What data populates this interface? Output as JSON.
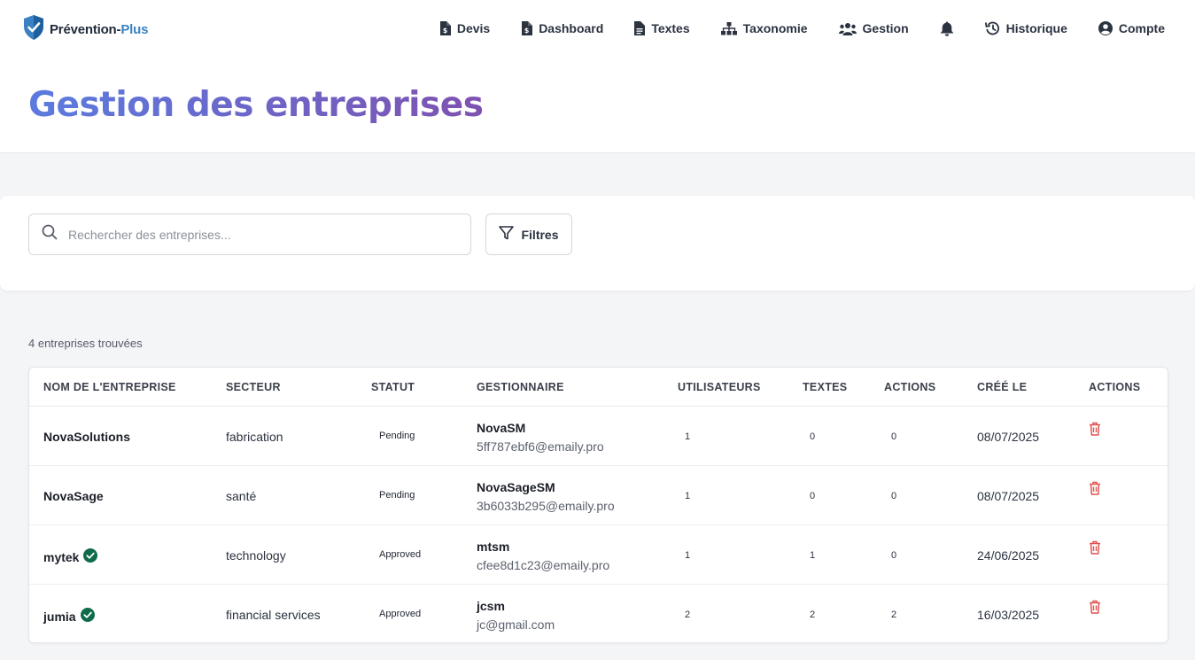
{
  "brand": {
    "name_main": "Prévention-",
    "name_accent": "Plus",
    "logo": "shield-check-icon"
  },
  "nav": [
    {
      "label": "Devis",
      "icon": "invoice-icon"
    },
    {
      "label": "Dashboard",
      "icon": "invoice-icon"
    },
    {
      "label": "Textes",
      "icon": "document-icon"
    },
    {
      "label": "Taxonomie",
      "icon": "sitemap-icon"
    },
    {
      "label": "Gestion",
      "icon": "users-icon"
    },
    {
      "label": "",
      "icon": "bell-icon"
    },
    {
      "label": "Historique",
      "icon": "history-icon"
    },
    {
      "label": "Compte",
      "icon": "user-circle-icon"
    }
  ],
  "page": {
    "title": "Gestion des entreprises"
  },
  "search": {
    "placeholder": "Rechercher des entreprises...",
    "value": ""
  },
  "filters": {
    "label": "Filtres"
  },
  "results": {
    "count_text": "4 entreprises trouvées"
  },
  "table": {
    "headers": [
      "Nom de l'entreprise",
      "Secteur",
      "Statut",
      "Gestionnaire",
      "Utilisateurs",
      "Textes",
      "Actions",
      "Créé le",
      "Actions"
    ],
    "rows": [
      {
        "name": "NovaSolutions",
        "verified": false,
        "sector": "fabrication",
        "status": "Pending",
        "manager": "NovaSM",
        "email": "5ff787ebf6@emaily.pro",
        "users": "1",
        "texts": "0",
        "actions": "0",
        "created": "08/07/2025"
      },
      {
        "name": "NovaSage",
        "verified": false,
        "sector": "santé",
        "status": "Pending",
        "manager": "NovaSageSM",
        "email": "3b6033b295@emaily.pro",
        "users": "1",
        "texts": "0",
        "actions": "0",
        "created": "08/07/2025"
      },
      {
        "name": "mytek",
        "verified": true,
        "sector": "technology",
        "status": "Approved",
        "manager": "mtsm",
        "email": "cfee8d1c23@emaily.pro",
        "users": "1",
        "texts": "1",
        "actions": "0",
        "created": "24/06/2025"
      },
      {
        "name": "jumia",
        "verified": true,
        "sector": "financial services",
        "status": "Approved",
        "manager": "jcsm",
        "email": "jc@gmail.com",
        "users": "2",
        "texts": "2",
        "actions": "2",
        "created": "16/03/2025"
      }
    ]
  },
  "colors": {
    "accent_start": "#5b7bdf",
    "accent_end": "#7e52b0",
    "verified": "#0f6b4a",
    "delete": "#e05252",
    "brand_blue": "#3b82c4"
  }
}
